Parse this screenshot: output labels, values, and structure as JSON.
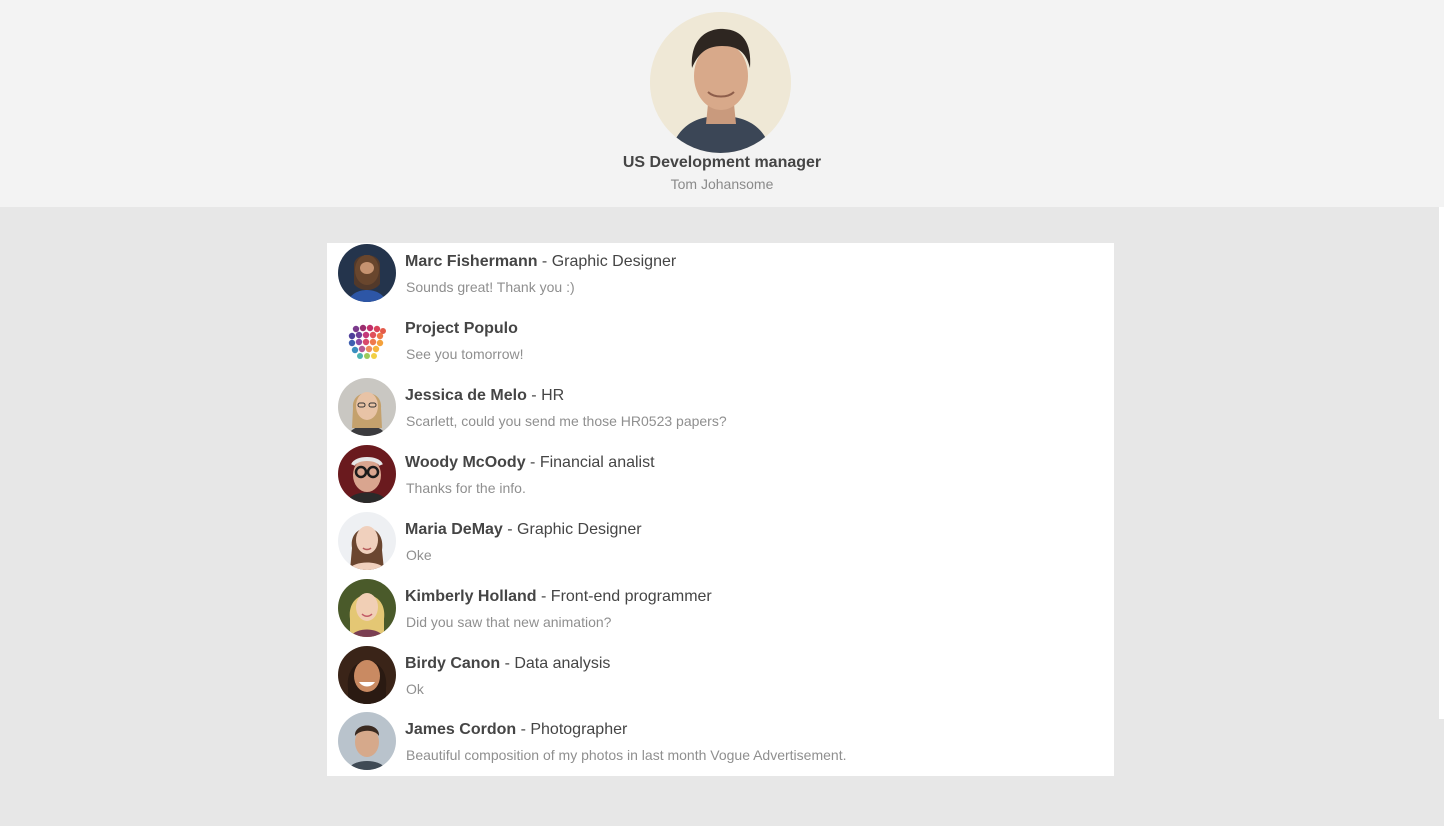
{
  "profile": {
    "title": "US Development manager",
    "name": "Tom Johansome"
  },
  "conversations": [
    {
      "name": "Marc Fishermann",
      "separator": " - ",
      "role": "Graphic Designer",
      "message": "Sounds great! Thank you :)"
    },
    {
      "name": "Project Populo",
      "separator": "",
      "role": "",
      "message": "See you tomorrow!"
    },
    {
      "name": "Jessica de Melo",
      "separator": " - ",
      "role": "HR",
      "message": "Scarlett, could you send me those HR0523 papers?"
    },
    {
      "name": "Woody McOody",
      "separator": " - ",
      "role": "Financial analist",
      "message": "Thanks for the info."
    },
    {
      "name": "Maria DeMay",
      "separator": " - ",
      "role": "Graphic Designer",
      "message": "Oke"
    },
    {
      "name": "Kimberly Holland",
      "separator": " - ",
      "role": "Front-end programmer",
      "message": "Did you saw that new animation?"
    },
    {
      "name": "Birdy Canon",
      "separator": " - ",
      "role": "Data analysis",
      "message": "Ok"
    },
    {
      "name": "James Cordon",
      "separator": " - ",
      "role": "Photographer",
      "message": "Beautiful composition of my photos in last month Vogue Advertisement."
    }
  ],
  "colors": {
    "header_bg": "#f3f3f3",
    "page_bg": "#e7e7e7",
    "panel_bg": "#ffffff",
    "name_text": "#454545",
    "message_text": "#8f8f8f"
  }
}
